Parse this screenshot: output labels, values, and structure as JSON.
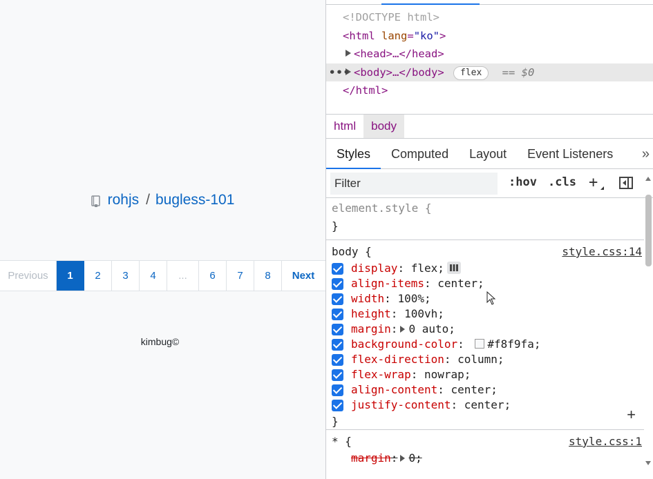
{
  "page": {
    "repo": {
      "owner": "rohjs",
      "separator": "/",
      "name": "bugless-101"
    },
    "pagination": {
      "previous": "Previous",
      "pages": [
        "1",
        "2",
        "3",
        "4"
      ],
      "ellipsis": "...",
      "pages_after": [
        "6",
        "7",
        "8"
      ],
      "next": "Next",
      "active": "1"
    },
    "footer": "kimbug©",
    "colors": {
      "link": "#0b66c3",
      "background": "#f8f9fa"
    }
  },
  "devtools": {
    "dom": {
      "doctype": "<!DOCTYPE html>",
      "html_open_tag": "<html",
      "html_attr_name": "lang",
      "html_attr_value": "\"ko\"",
      "head": "<head>…</head>",
      "body": "<body>…</body>",
      "flex_badge": "flex",
      "selected_hint": "== $0",
      "html_close": "</html>",
      "dots": "•••"
    },
    "breadcrumbs": [
      "html",
      "body"
    ],
    "tabs": [
      "Styles",
      "Computed",
      "Layout",
      "Event Listeners"
    ],
    "tabs_more": "»",
    "toolbar": {
      "filter_placeholder": "Filter",
      "hov": ":hov",
      "cls": ".cls",
      "plus": "+"
    },
    "element_style": {
      "selector": "element.style {",
      "close": "}"
    },
    "body_rule": {
      "selector": "body {",
      "source": "style.css:14",
      "declarations": [
        {
          "prop": "display",
          "value": "flex;"
        },
        {
          "prop": "align-items",
          "value": "center;"
        },
        {
          "prop": "width",
          "value": "100%;"
        },
        {
          "prop": "height",
          "value": "100vh;"
        },
        {
          "prop": "margin",
          "value": "0 auto;"
        },
        {
          "prop": "background-color",
          "value": "#f8f9fa;"
        },
        {
          "prop": "flex-direction",
          "value": "column;"
        },
        {
          "prop": "flex-wrap",
          "value": "nowrap;"
        },
        {
          "prop": "align-content",
          "value": "center;"
        },
        {
          "prop": "justify-content",
          "value": "center;"
        }
      ],
      "close": "}"
    },
    "star_rule": {
      "selector": "* {",
      "source": "style.css:1",
      "declaration": {
        "prop": "margin",
        "value": "0;"
      }
    },
    "colors": {
      "accent": "#1a73e8",
      "property": "#c80000",
      "tag": "#881280"
    }
  }
}
